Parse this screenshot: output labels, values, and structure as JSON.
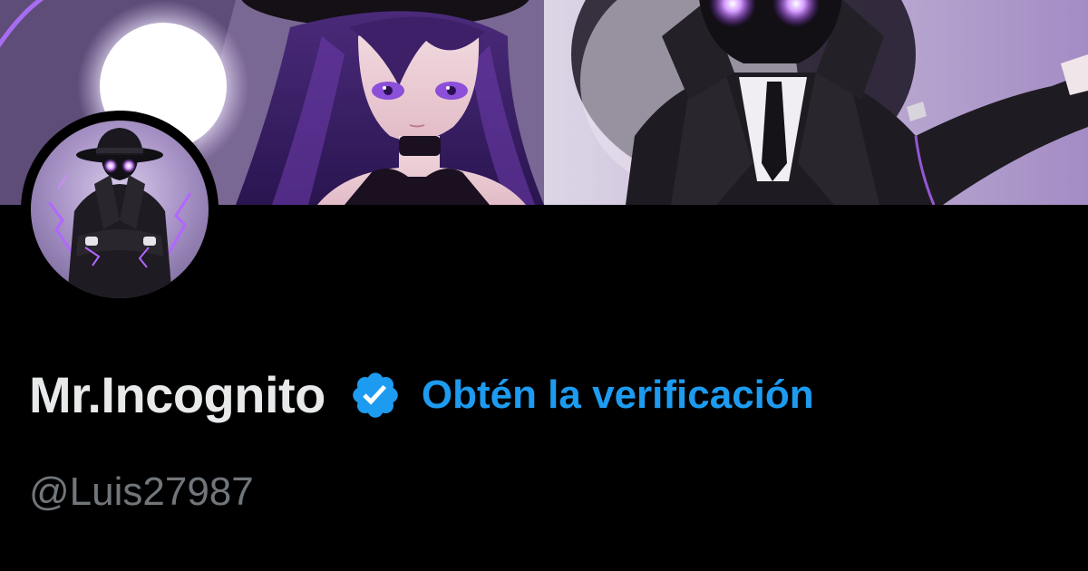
{
  "profile": {
    "display_name": "Mr.Incognito",
    "handle": "@Luis27987",
    "get_verified_label": "Obtén la verificación",
    "verified_badge_icon": "verified-badge-icon",
    "banner_image": "anime-style-illustration-woman-purple-hair-and-masked-man",
    "avatar_image": "masked-man-with-fedora-purple-lightning"
  },
  "colors": {
    "background": "#000000",
    "name_text": "#e7e9ea",
    "handle_text": "#71767b",
    "accent_blue": "#1d9bf0",
    "banner_purple": "#8d7aa8",
    "glow_purple": "#b366ff"
  }
}
